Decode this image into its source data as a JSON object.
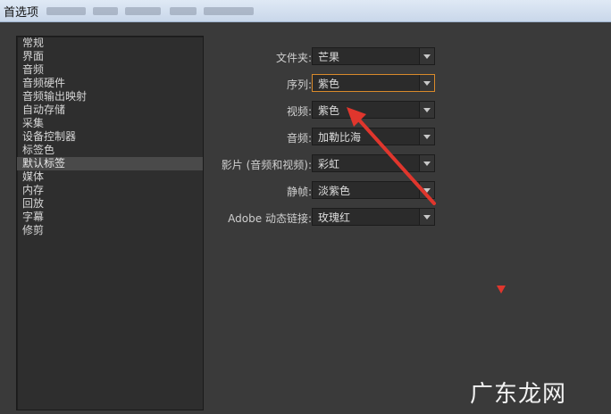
{
  "window": {
    "title": "首选项"
  },
  "sidebar": {
    "items": [
      {
        "label": "常规"
      },
      {
        "label": "界面"
      },
      {
        "label": "音频"
      },
      {
        "label": "音频硬件"
      },
      {
        "label": "音频输出映射"
      },
      {
        "label": "自动存储"
      },
      {
        "label": "采集"
      },
      {
        "label": "设备控制器"
      },
      {
        "label": "标签色"
      },
      {
        "label": "默认标签",
        "selected": true
      },
      {
        "label": "媒体"
      },
      {
        "label": "内存"
      },
      {
        "label": "回放"
      },
      {
        "label": "字幕"
      },
      {
        "label": "修剪"
      }
    ]
  },
  "form": {
    "rows": [
      {
        "label": "文件夹:",
        "value": "芒果"
      },
      {
        "label": "序列:",
        "value": "紫色",
        "focused": true
      },
      {
        "label": "视频:",
        "value": "紫色"
      },
      {
        "label": "音频:",
        "value": "加勒比海"
      },
      {
        "label": "影片 (音频和视频):",
        "value": "彩虹"
      },
      {
        "label": "静帧:",
        "value": "淡紫色"
      },
      {
        "label": "Adobe 动态链接:",
        "value": "玫瑰红"
      }
    ]
  },
  "colors": {
    "annotation_arrow": "#e0362d",
    "focus_border": "#d98a2b"
  },
  "watermark": {
    "text": "广东龙网"
  }
}
